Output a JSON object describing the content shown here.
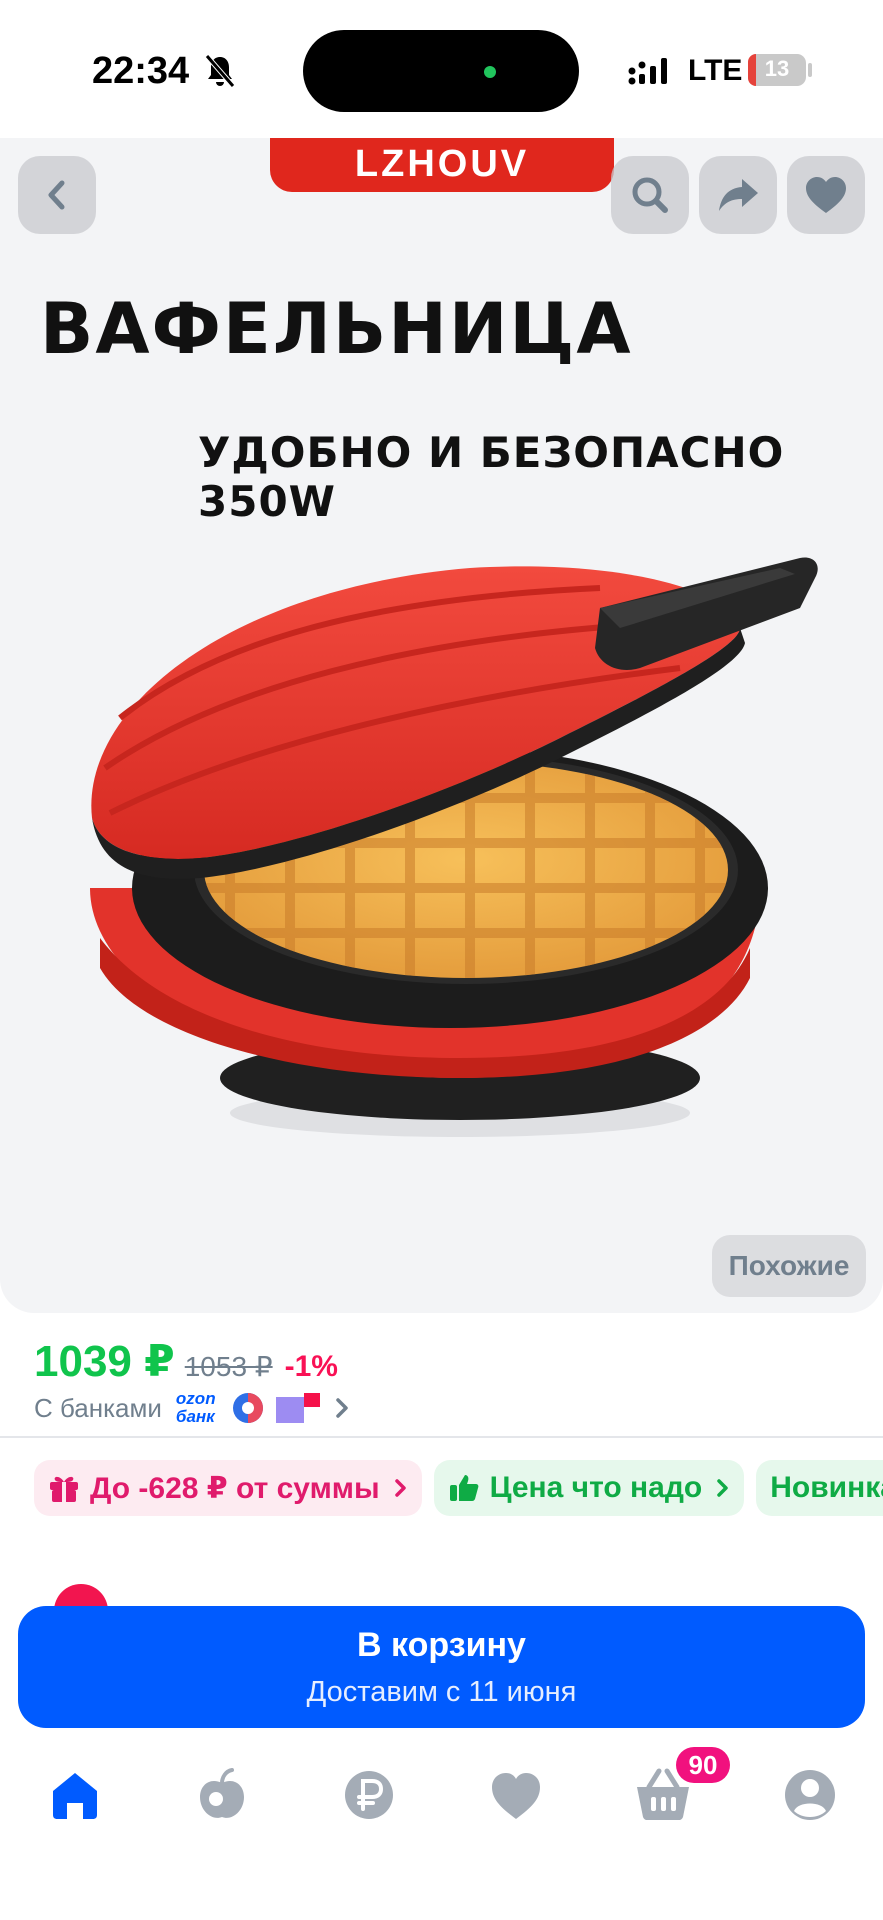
{
  "status_bar": {
    "time": "22:34",
    "network": "LTE",
    "battery": "13",
    "battery_level_percent": 13,
    "icons": [
      "bell-off-icon",
      "signal-icon",
      "battery-charging-icon"
    ]
  },
  "gallery": {
    "brand": "LZHOUV",
    "headline": "ВАФЕЛЬНИЦА",
    "subline": "УДОБНО И БЕЗОПАСНО  350W",
    "similar_label": "Похожие",
    "icons": [
      "back-icon",
      "search-icon",
      "share-icon",
      "heart-icon"
    ]
  },
  "price": {
    "current": "1039 ₽",
    "old": "1053 ₽",
    "discount": "-1%",
    "banks_label": "С банками",
    "ozon_bank_line1": "ozon",
    "ozon_bank_line2": "банк"
  },
  "chips": [
    {
      "label": "До -628 ₽ от суммы",
      "icon": "gift-icon"
    },
    {
      "label": "Цена что надо",
      "icon": "thumbs-up-icon"
    },
    {
      "label": "Новинка",
      "icon": ""
    }
  ],
  "cart_button": {
    "title": "В корзину",
    "subtitle": "Доставим с 11 июня"
  },
  "tab_bar": {
    "items": [
      "home-icon",
      "fresh-icon",
      "ruble-icon",
      "favorites-icon",
      "cart-icon",
      "profile-icon"
    ],
    "cart_badge": "90"
  },
  "colors": {
    "accent": "#005bff",
    "price_green": "#10c44c",
    "discount_red": "#f91155",
    "brand_red": "#e0271d",
    "badge_pink": "#f1117e"
  }
}
